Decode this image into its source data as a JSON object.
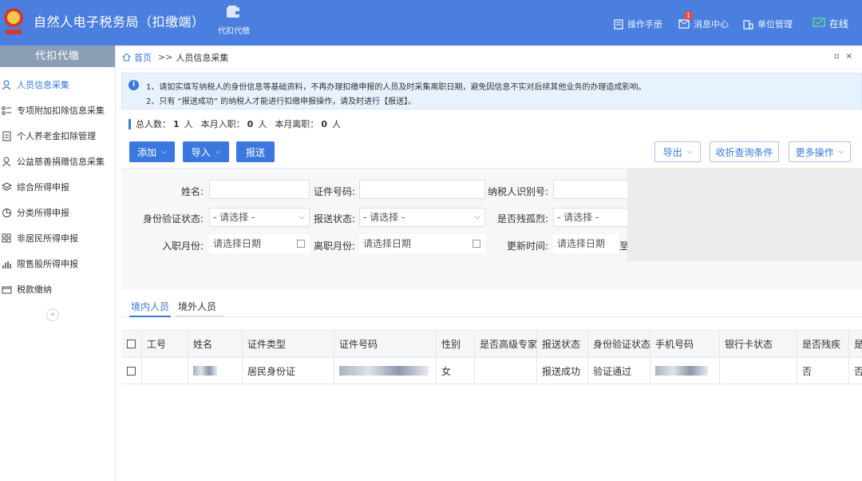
{
  "header": {
    "app_title": "自然人电子税务局（扣缴端）",
    "module_label": "代扣代缴",
    "manual_label": "操作手册",
    "messages_label": "消息中心",
    "messages_badge": "1",
    "unit_label": "单位管理",
    "online_label": "在线",
    "accent_color": "#4a7fe0"
  },
  "sidebar": {
    "title": "代扣代缴",
    "collapse_glyph": "«",
    "items": [
      {
        "label": "人员信息采集",
        "icon": "user-icon",
        "active": true
      },
      {
        "label": "专项附加扣除信息采集",
        "icon": "list-icon"
      },
      {
        "label": "个人养老金扣除管理",
        "icon": "document-icon"
      },
      {
        "label": "公益慈善捐赠信息采集",
        "icon": "donation-icon"
      },
      {
        "label": "综合所得申报",
        "icon": "layers-icon"
      },
      {
        "label": "分类所得申报",
        "icon": "pie-icon"
      },
      {
        "label": "非居民所得申报",
        "icon": "grid-icon"
      },
      {
        "label": "限售股所得申报",
        "icon": "bar-chart-icon"
      },
      {
        "label": "税款缴纳",
        "icon": "wallet-icon"
      }
    ]
  },
  "breadcrumb": {
    "home": "首页",
    "sep": ">>",
    "current": "人员信息采集"
  },
  "notice": {
    "line1": "1、请如实填写纳税人的身份信息等基础资料，不再办理扣缴申报的人员及时采集离职日期，避免因信息不实对后续其他业务的办理造成影响。",
    "line2": "2、只有 “报送成功” 的纳税人才能进行扣缴申报操作，请及时进行【报送】。"
  },
  "stats": {
    "total_label": "总人数：",
    "total_value": "1",
    "total_unit": "人",
    "joined_label": "本月入职：",
    "joined_value": "0",
    "joined_unit": "人",
    "left_label": "本月离职：",
    "left_value": "0",
    "left_unit": "人"
  },
  "toolbar": {
    "add": "添加",
    "import": "导入",
    "submit": "报送",
    "export": "导出",
    "collapse_query": "收折查询条件",
    "more": "更多操作",
    "caret": "⌵"
  },
  "filters": {
    "name_label": "姓名:",
    "id_no_label": "证件号码:",
    "taxpayer_id_label": "纳税人识别号:",
    "id_verify_label": "身份验证状态:",
    "id_verify_value": "- 请选择 -",
    "submit_status_label": "报送状态:",
    "submit_status_value": "- 请选择 -",
    "disabled_label": "是否残孤烈:",
    "disabled_value": "- 请选择 -",
    "entry_month_label": "入职月份:",
    "entry_month_placeholder": "请选择日期",
    "leave_month_label": "离职月份:",
    "leave_month_placeholder": "请选择日期",
    "update_time_label": "更新时间:",
    "update_time_placeholder": "请选择日期",
    "to_label": "至"
  },
  "tabs": {
    "domestic": "境内人员",
    "foreign": "境外人员"
  },
  "table": {
    "columns": [
      "工号",
      "姓名",
      "证件类型",
      "证件号码",
      "性别",
      "是否高级专家",
      "报送状态",
      "身份验证状态",
      "手机号码",
      "银行卡状态",
      "是否残疾",
      "是"
    ],
    "rows": [
      {
        "id_type": "居民身份证",
        "gender": "女",
        "submit_status": "报送成功",
        "verify_status": "验证通过",
        "disabled": "否",
        "last": "否"
      }
    ]
  }
}
